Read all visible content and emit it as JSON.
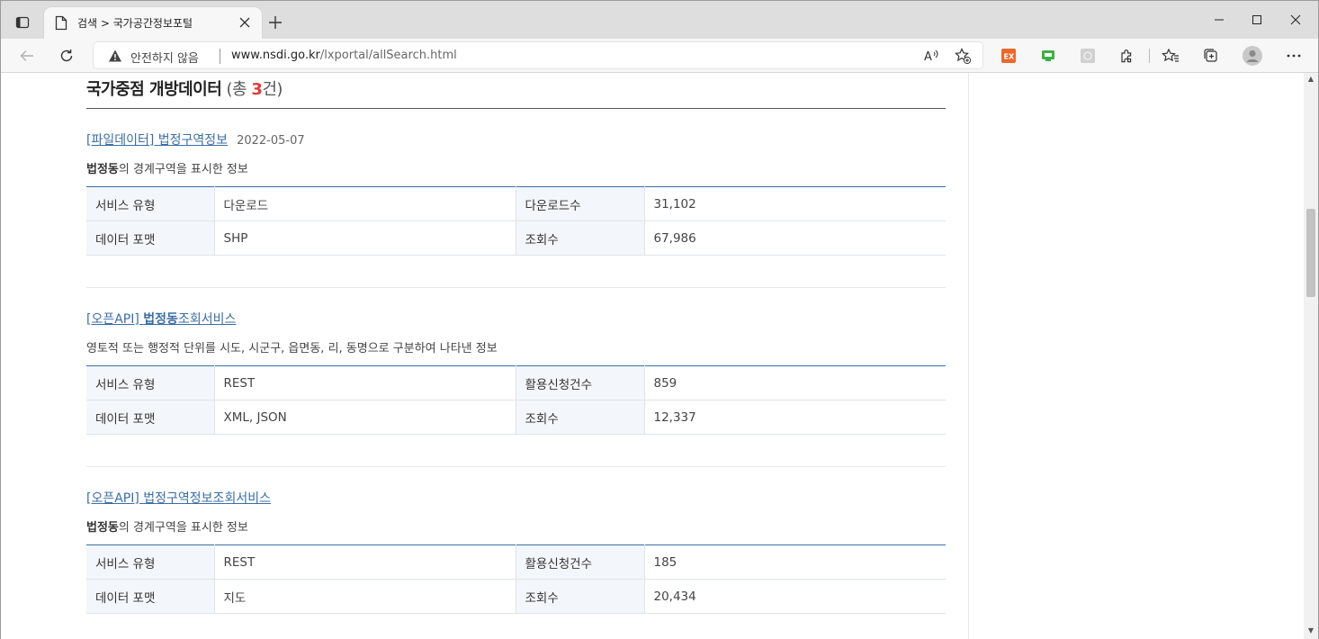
{
  "browser": {
    "tab_title": "검색 > 국가공간정보포털",
    "security_label": "안전하지 않음",
    "url_host": "www.nsdi.go.kr",
    "url_path": "/lxportal/allSearch.html"
  },
  "section": {
    "title": "국가중점 개방데이터",
    "count_prefix": " (총 ",
    "count": "3",
    "count_suffix": "건)"
  },
  "items": [
    {
      "title": "[파일데이터] 법정구역정보",
      "date": "2022-05-07",
      "desc_bold": "법정동",
      "desc_rest": "의 경계구역을 표시한 정보",
      "rows": [
        {
          "k1": "서비스 유형",
          "v1": "다운로드",
          "k2": "다운로드수",
          "v2": "31,102"
        },
        {
          "k1": "데이터 포맷",
          "v1": "SHP",
          "k2": "조회수",
          "v2": "67,986"
        }
      ]
    },
    {
      "title_prefix": "[오픈API] ",
      "title_bold": "법정동",
      "title_rest": "조회서비스",
      "desc": "영토적 또는 행정적 단위를 시도, 시군구, 읍면동, 리, 동명으로 구분하여 나타낸 정보",
      "rows": [
        {
          "k1": "서비스 유형",
          "v1": "REST",
          "k2": "활용신청건수",
          "v2": "859"
        },
        {
          "k1": "데이터 포맷",
          "v1": "XML, JSON",
          "k2": "조회수",
          "v2": "12,337"
        }
      ]
    },
    {
      "title": "[오픈API] 법정구역정보조회서비스",
      "desc_bold": "법정동",
      "desc_rest": "의 경계구역을 표시한 정보",
      "rows": [
        {
          "k1": "서비스 유형",
          "v1": "REST",
          "k2": "활용신청건수",
          "v2": "185"
        },
        {
          "k1": "데이터 포맷",
          "v1": "지도",
          "k2": "조회수",
          "v2": "20,434"
        }
      ]
    }
  ],
  "colors": {
    "link": "#3a6ea5",
    "count_accent": "#e03a3a"
  },
  "icons": [
    "tab-actions-icon",
    "page-icon",
    "close-icon",
    "plus-icon",
    "back-arrow-icon",
    "refresh-icon",
    "warning-icon",
    "read-aloud-icon",
    "favorite-add-icon",
    "extension-ex-icon",
    "extension-green-icon",
    "extension-gray-icon",
    "puzzle-icon",
    "favorites-icon",
    "collections-icon",
    "profile-icon",
    "more-icon",
    "minimize-icon",
    "maximize-icon",
    "window-close-icon"
  ]
}
